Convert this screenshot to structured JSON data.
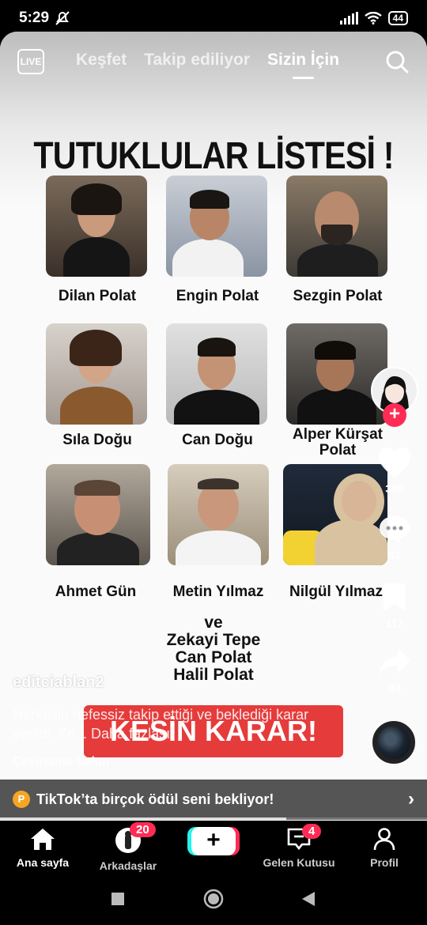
{
  "status": {
    "time": "5:29",
    "battery": "44"
  },
  "topnav": {
    "live_label": "LIVE",
    "tabs": [
      {
        "label": "Keşfet"
      },
      {
        "label": "Takip ediliyor"
      },
      {
        "label": "Sizin İçin"
      }
    ]
  },
  "video": {
    "headline": "TUTUKLULAR LİSTESİ !",
    "people": [
      {
        "name": "Dilan Polat"
      },
      {
        "name": "Engin Polat"
      },
      {
        "name": "Sezgin Polat"
      },
      {
        "name": "Sıla Doğu"
      },
      {
        "name": "Can Doğu"
      },
      {
        "name": "Alper Kürşat Polat"
      },
      {
        "name": "Ahmet Gün"
      },
      {
        "name": "Metin Yılmaz"
      },
      {
        "name": "Nilgül Yılmaz"
      }
    ],
    "ve": "ve",
    "extra_names": [
      "Zekayi Tepe",
      "Can Polat",
      "Halil Polat"
    ],
    "banner": "KESİN KARAR!"
  },
  "post": {
    "author": "editciablan2",
    "caption": "Herkesin nefessiz takip ettiği ve beklediği karar verildi. Ke... Daha fazlası",
    "translate": "Çevirisine bakın"
  },
  "rail": {
    "likes": "305",
    "comments": "51",
    "saves": "117",
    "shares": "34"
  },
  "promo": {
    "coin": "P",
    "text": "TikTok’ta birçok ödül seni bekliyor!"
  },
  "bottomnav": {
    "home": "Ana sayfa",
    "friends": "Arkadaşlar",
    "friends_badge": "20",
    "inbox": "Gelen Kutusu",
    "inbox_badge": "4",
    "profile": "Profil"
  },
  "colors": {
    "accent": "#fe2c55",
    "cyan": "#25f4ee",
    "banner": "#e63b3b"
  }
}
